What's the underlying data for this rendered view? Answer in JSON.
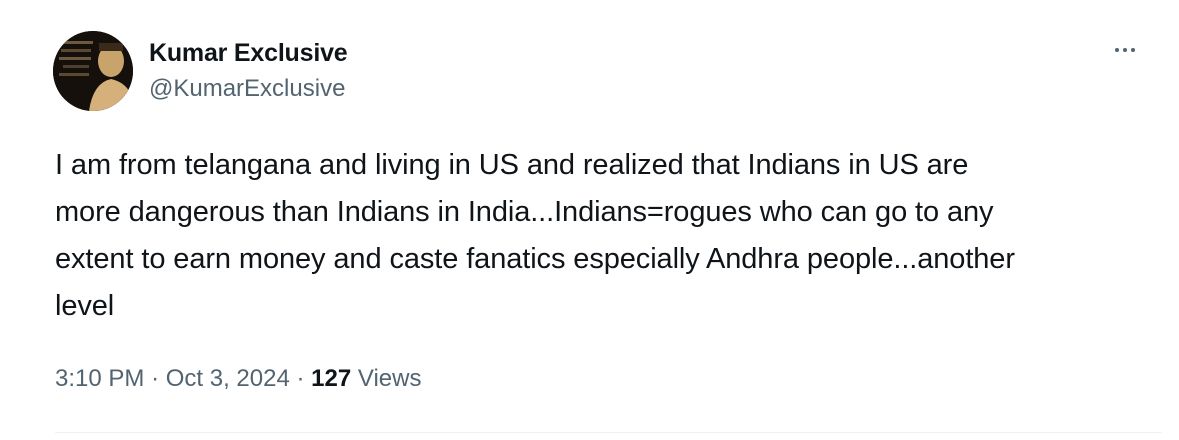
{
  "tweet": {
    "author": {
      "display_name": "Kumar Exclusive",
      "handle": "@KumarExclusive"
    },
    "more_icon": "more-horizontal-icon",
    "text": "I am from telangana and living in US and realized that Indians in US are\nmore dangerous than Indians in India...Indians=rogues who can go to any\nextent to earn money and caste fanatics especially Andhra people...another\nlevel",
    "time": "3:10 PM",
    "separator": "·",
    "date": "Oct 3, 2024",
    "views_count": "127",
    "views_label": "Views"
  },
  "colors": {
    "text_primary": "#0f1419",
    "text_secondary": "#536471",
    "divider": "#eff3f4",
    "background": "#ffffff"
  }
}
